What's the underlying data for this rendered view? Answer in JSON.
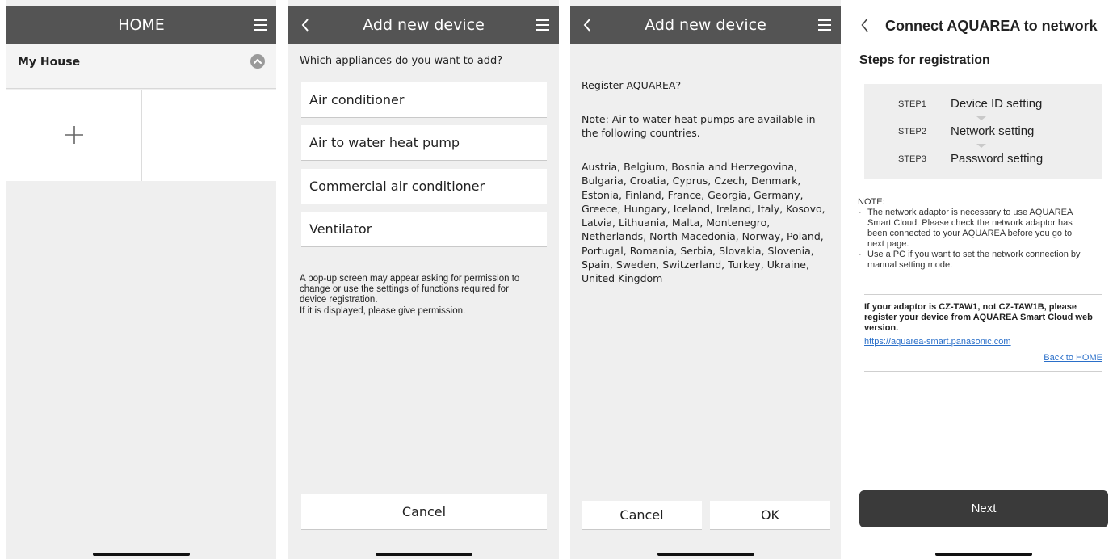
{
  "screen1": {
    "title": "HOME",
    "house_name": "My House",
    "icons": {
      "menu": "menu-icon",
      "collapse": "chevron-up-icon",
      "add": "plus-icon"
    }
  },
  "screen2": {
    "title": "Add new device",
    "question": "Which appliances do you want to add?",
    "options": [
      "Air conditioner",
      "Air to water heat pump",
      "Commercial air conditioner",
      "Ventilator"
    ],
    "note_lines": [
      "A pop-up screen may appear asking for permission to",
      "change or use the settings of functions required for",
      "device registration.",
      "If it is displayed, please give permission."
    ],
    "cancel": "Cancel"
  },
  "screen3": {
    "title": "Add new device",
    "question": "Register AQUAREA?",
    "note_lines": [
      "Note: Air to water heat pumps are available in",
      "the following countries."
    ],
    "country_lines": [
      "Austria, Belgium, Bosnia and Herzegovina,",
      "Bulgaria, Croatia, Cyprus, Czech, Denmark,",
      "Estonia, Finland, France, Georgia, Germany,",
      "Greece, Hungary, Iceland, Ireland, Italy, Kosovo,",
      "Latvia, Lithuania, Malta, Montenegro,",
      "Netherlands, North Macedonia, Norway, Poland,",
      "Portugal, Romania, Serbia, Slovakia, Slovenia,",
      "Spain, Sweden, Switzerland, Turkey, Ukraine,",
      "United Kingdom"
    ],
    "cancel": "Cancel",
    "ok": "OK"
  },
  "screen4": {
    "title": "Connect AQUAREA to network",
    "steps_title": "Steps for registration",
    "steps": [
      {
        "num": "STEP1",
        "label": "Device ID setting"
      },
      {
        "num": "STEP2",
        "label": "Network setting"
      },
      {
        "num": "STEP3",
        "label": "Password setting"
      }
    ],
    "note_label": "NOTE:",
    "bullet": "·",
    "note1_lines": [
      "The network adaptor is necessary to use AQUAREA",
      "Smart Cloud. Please check the network adaptor has",
      "been connected to your AQUAREA before you go to",
      "next page."
    ],
    "note2_lines": [
      "Use a PC if you want to set the network connection by",
      "manual setting mode."
    ],
    "adaptor_lines": [
      "If your adaptor is CZ-TAW1, not CZ-TAW1B, please",
      "register your device from AQUAREA Smart Cloud web",
      "version."
    ],
    "url": "https://aquarea-smart.panasonic.com",
    "back_home": "Back to HOME",
    "next": "Next"
  }
}
